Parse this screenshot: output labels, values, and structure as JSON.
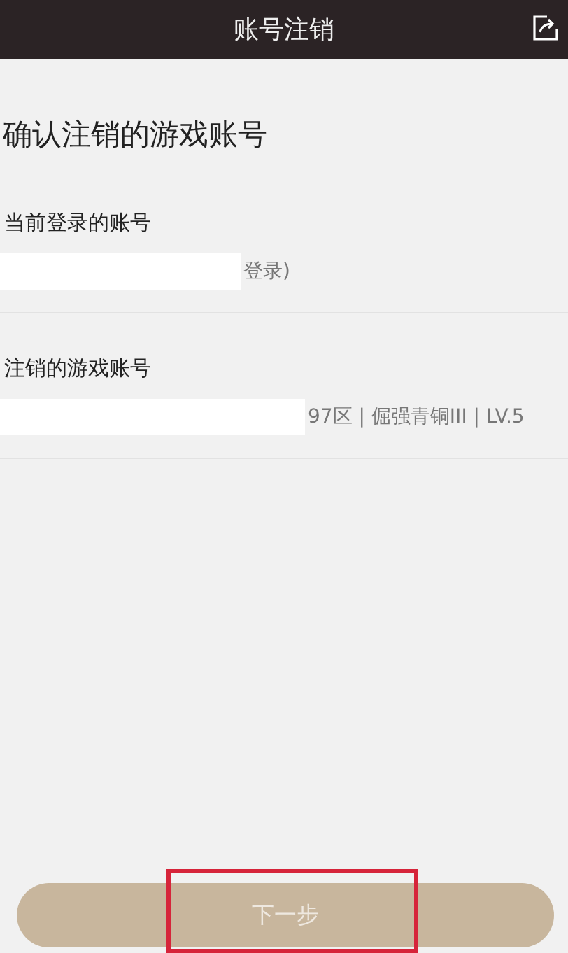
{
  "header": {
    "title": "账号注销"
  },
  "heading": "确认注销的游戏账号",
  "sections": [
    {
      "label": "当前登录的账号",
      "value": "登录)"
    },
    {
      "label": "注销的游戏账号",
      "value": "97区 | 倔强青铜III | LV.5"
    }
  ],
  "next_button": {
    "label": "下一步",
    "highlighted": true
  }
}
